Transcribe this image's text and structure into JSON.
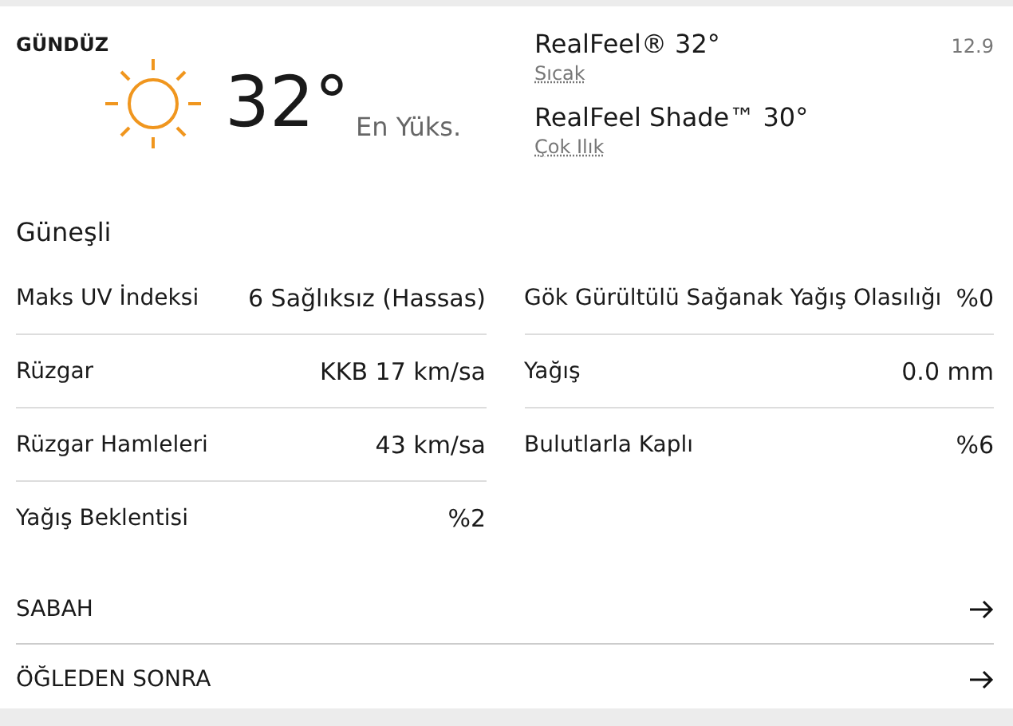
{
  "header": {
    "label": "GÜNDÜZ",
    "temperature": "32°",
    "temperature_caption": "En Yüks.",
    "realfeel": "RealFeel® 32°",
    "realfeel_phrase": "Sıcak",
    "realfeel_shade": "RealFeel Shade™ 30°",
    "realfeel_shade_phrase": "Çok Ilık",
    "date": "12.9"
  },
  "condition": "Güneşli",
  "details_left": [
    {
      "label": "Maks UV İndeksi",
      "value": "6 Sağlıksız (Hassas)"
    },
    {
      "label": "Rüzgar",
      "value": "KKB 17 km/sa"
    },
    {
      "label": "Rüzgar Hamleleri",
      "value": "43 km/sa"
    },
    {
      "label": "Yağış Beklentisi",
      "value": "%2"
    }
  ],
  "details_right": [
    {
      "label": "Gök Gürültülü Sağanak Yağış Olasılığı",
      "value": "%0"
    },
    {
      "label": "Yağış",
      "value": "0.0 mm"
    },
    {
      "label": "Bulutlarla Kaplı",
      "value": "%6"
    }
  ],
  "periods": [
    {
      "label": "SABAH"
    },
    {
      "label": "ÖĞLEDEN SONRA"
    }
  ]
}
